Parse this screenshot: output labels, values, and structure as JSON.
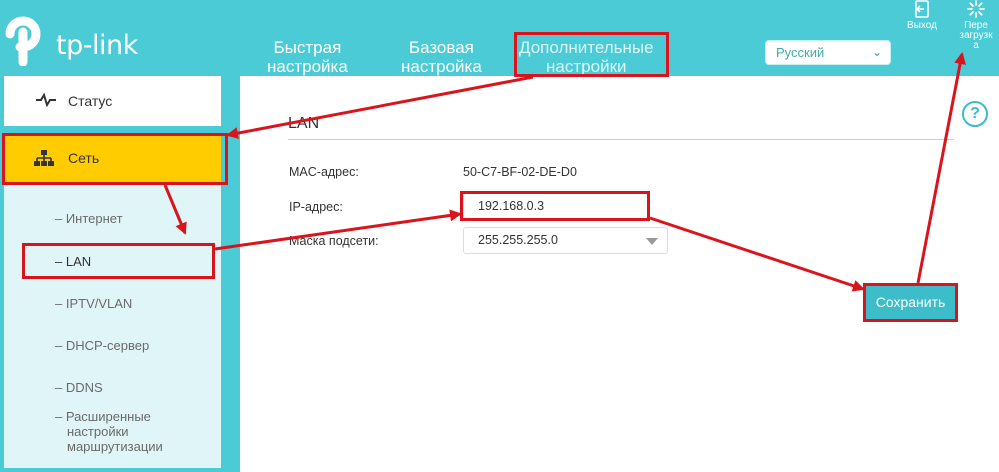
{
  "header": {
    "brand": "tp-link",
    "nav": [
      {
        "line1": "Быстрая",
        "line2": "настройка"
      },
      {
        "line1": "Базовая",
        "line2": "настройка"
      },
      {
        "line1": "Дополнительные",
        "line2": "настройки"
      }
    ],
    "language": "Русский",
    "logout_label": "Выход",
    "reboot_label": [
      "Пере",
      "загрузк",
      "а"
    ],
    "icons": {
      "logout": "logout-icon",
      "reboot": "reboot-icon",
      "language": "chevron-down-icon"
    }
  },
  "sidebar": {
    "status_label": "Статус",
    "network_label": "Сеть",
    "subitems": [
      "– Интернет",
      "– LAN",
      "– IPTV/VLAN",
      "– DHCP-сервер",
      "– DDNS",
      "– Расширенные"
    ],
    "routing_extra": [
      "настройки",
      "маршрутизации"
    ],
    "icons": {
      "status": "pulse-icon",
      "network": "network-icon"
    }
  },
  "main": {
    "section_title": "LAN",
    "mac_label": "MAC-адрес:",
    "mac_value": "50-C7-BF-02-DE-D0",
    "ip_label": "IP-адрес:",
    "ip_value": "192.168.0.3",
    "mask_label": "Маска подсети:",
    "mask_value": "255.255.255.0",
    "save_label": "Сохранить",
    "help_icon": "help-icon"
  },
  "colors": {
    "accent": "#4acbd6",
    "active_item": "#ffcc00",
    "annotation": "#d9141c",
    "save": "#3dbdc9"
  }
}
